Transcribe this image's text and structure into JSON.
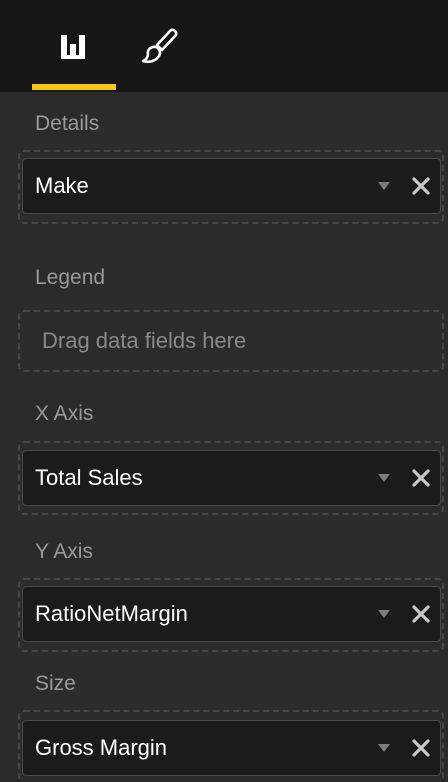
{
  "tabs": [
    {
      "name": "fields",
      "icon": "bar-chart-icon",
      "active": true
    },
    {
      "name": "format",
      "icon": "paintbrush-icon",
      "active": false
    }
  ],
  "accent_color": "#f2c811",
  "sections": {
    "details": {
      "label": "Details",
      "field": "Make"
    },
    "legend": {
      "label": "Legend",
      "placeholder": "Drag data fields here"
    },
    "x_axis": {
      "label": "X Axis",
      "field": "Total Sales"
    },
    "y_axis": {
      "label": "Y Axis",
      "field": "RatioNetMargin"
    },
    "size": {
      "label": "Size",
      "field": "Gross Margin"
    }
  },
  "icons": {
    "dropdown": "chevron-down-icon",
    "remove": "close-icon"
  }
}
